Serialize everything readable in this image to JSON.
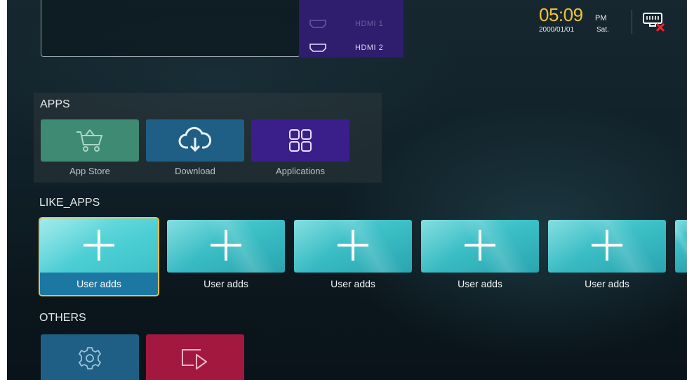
{
  "sources": {
    "items": [
      {
        "label": "HDMI 1",
        "state": "inactive"
      },
      {
        "label": "HDMI 2",
        "state": "active"
      }
    ]
  },
  "status": {
    "time": "05:09",
    "ampm": "PM",
    "date": "2000/01/01",
    "day": "Sat.",
    "network_icon": "ethernet-disconnected-icon",
    "time_color": "#f2c23b"
  },
  "apps": {
    "title": "APPS",
    "items": [
      {
        "label": "App Store",
        "icon": "shopping-cart-icon",
        "color": "#3f8a72"
      },
      {
        "label": "Download",
        "icon": "cloud-download-icon",
        "color": "#1f5f86"
      },
      {
        "label": "Applications",
        "icon": "app-grid-icon",
        "color": "#3a1f8a"
      }
    ]
  },
  "like_apps": {
    "title": "LIKE_APPS",
    "items": [
      {
        "label": "User adds",
        "icon": "plus-icon",
        "focused": true
      },
      {
        "label": "User adds",
        "icon": "plus-icon",
        "focused": false
      },
      {
        "label": "User adds",
        "icon": "plus-icon",
        "focused": false
      },
      {
        "label": "User adds",
        "icon": "plus-icon",
        "focused": false
      },
      {
        "label": "User adds",
        "icon": "plus-icon",
        "focused": false
      }
    ],
    "focus_color": "#e8c04a"
  },
  "others": {
    "title": "OTHERS",
    "items": [
      {
        "icon": "gear-icon",
        "color": "#1f5f86"
      },
      {
        "icon": "video-input-icon",
        "color": "#a3183f"
      }
    ]
  }
}
